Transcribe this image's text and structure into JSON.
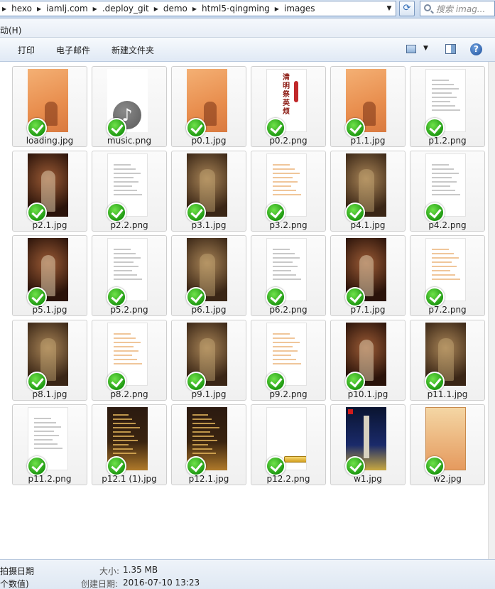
{
  "address_bar": {
    "path": [
      "hexo",
      "iamlj.com",
      ".deploy_git",
      "demo",
      "html5-qingming",
      "images"
    ],
    "search_placeholder": "搜索 imag..."
  },
  "menu": {
    "help_label": "动(H)"
  },
  "toolbar": {
    "print_label": "打印",
    "email_label": "电子邮件",
    "new_folder_label": "新建文件夹"
  },
  "files": [
    {
      "name": "loading.jpg",
      "thumb": "orange"
    },
    {
      "name": "music.png",
      "thumb": "music"
    },
    {
      "name": "p0.1.jpg",
      "thumb": "orange"
    },
    {
      "name": "p0.2.png",
      "thumb": "title"
    },
    {
      "name": "p1.1.jpg",
      "thumb": "orange"
    },
    {
      "name": "p1.2.png",
      "thumb": "doc"
    },
    {
      "name": "p2.1.jpg",
      "thumb": "warm"
    },
    {
      "name": "p2.2.png",
      "thumb": "doc"
    },
    {
      "name": "p3.1.jpg",
      "thumb": "brown"
    },
    {
      "name": "p3.2.png",
      "thumb": "doc-orange"
    },
    {
      "name": "p4.1.jpg",
      "thumb": "brown"
    },
    {
      "name": "p4.2.png",
      "thumb": "doc"
    },
    {
      "name": "p5.1.jpg",
      "thumb": "warm"
    },
    {
      "name": "p5.2.png",
      "thumb": "doc"
    },
    {
      "name": "p6.1.jpg",
      "thumb": "brown"
    },
    {
      "name": "p6.2.png",
      "thumb": "doc"
    },
    {
      "name": "p7.1.jpg",
      "thumb": "warm"
    },
    {
      "name": "p7.2.png",
      "thumb": "doc-orange"
    },
    {
      "name": "p8.1.jpg",
      "thumb": "brown"
    },
    {
      "name": "p8.2.png",
      "thumb": "doc-orange"
    },
    {
      "name": "p9.1.jpg",
      "thumb": "brown"
    },
    {
      "name": "p9.2.png",
      "thumb": "doc-orange"
    },
    {
      "name": "p10.1.jpg",
      "thumb": "warm"
    },
    {
      "name": "p11.1.jpg",
      "thumb": "brown"
    },
    {
      "name": "p11.2.png",
      "thumb": "doc"
    },
    {
      "name": "p12.1 (1).jpg",
      "thumb": "dark"
    },
    {
      "name": "p12.1.jpg",
      "thumb": "dark"
    },
    {
      "name": "p12.2.png",
      "thumb": "button"
    },
    {
      "name": "w1.jpg",
      "thumb": "night"
    },
    {
      "name": "w2.jpg",
      "thumb": "poster"
    }
  ],
  "details": {
    "line1_label": "拍摄日期",
    "line2_label": "个数值)",
    "size_label": "大小:",
    "size_value": "1.35 MB",
    "created_label": "创建日期:",
    "created_value": "2016-07-10 13:23"
  }
}
